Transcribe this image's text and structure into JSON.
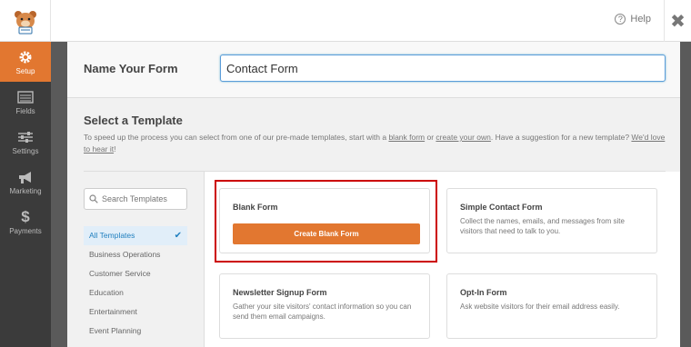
{
  "header": {
    "help_label": "Help",
    "close_glyph": "✖"
  },
  "sidebar": {
    "items": [
      {
        "label": "Setup",
        "icon": "gear-icon",
        "active": true
      },
      {
        "label": "Fields",
        "icon": "fields-icon",
        "active": false
      },
      {
        "label": "Settings",
        "icon": "sliders-icon",
        "active": false
      },
      {
        "label": "Marketing",
        "icon": "megaphone-icon",
        "active": false
      },
      {
        "label": "Payments",
        "icon": "dollar-icon",
        "active": false
      }
    ]
  },
  "form_name": {
    "label": "Name Your Form",
    "value": "Contact Form"
  },
  "templates": {
    "title": "Select a Template",
    "desc_prefix": "To speed up the process you can select from one of our pre-made templates, start with a ",
    "blank_form_link": "blank form",
    "desc_mid1": " or ",
    "create_own_link": "create your own",
    "desc_mid2": ". Have a suggestion for a new template? ",
    "love_link": "We'd love to hear it",
    "desc_suffix": "!",
    "search_placeholder": "Search Templates",
    "categories": [
      "All Templates",
      "Business Operations",
      "Customer Service",
      "Education",
      "Entertainment",
      "Event Planning"
    ],
    "cards": {
      "blank": {
        "title": "Blank Form",
        "button": "Create Blank Form"
      },
      "simple": {
        "title": "Simple Contact Form",
        "desc": "Collect the names, emails, and messages from site visitors that need to talk to you."
      },
      "newsletter": {
        "title": "Newsletter Signup Form",
        "desc": "Gather your site visitors' contact information so you can send them email campaigns."
      },
      "optin": {
        "title": "Opt-In Form",
        "desc": "Ask website visitors for their email address easily."
      }
    }
  },
  "colors": {
    "accent": "#e27730",
    "highlight": "#cc0000",
    "nav_bg": "#3b3b3b",
    "link_blue": "#1f7fbf"
  }
}
